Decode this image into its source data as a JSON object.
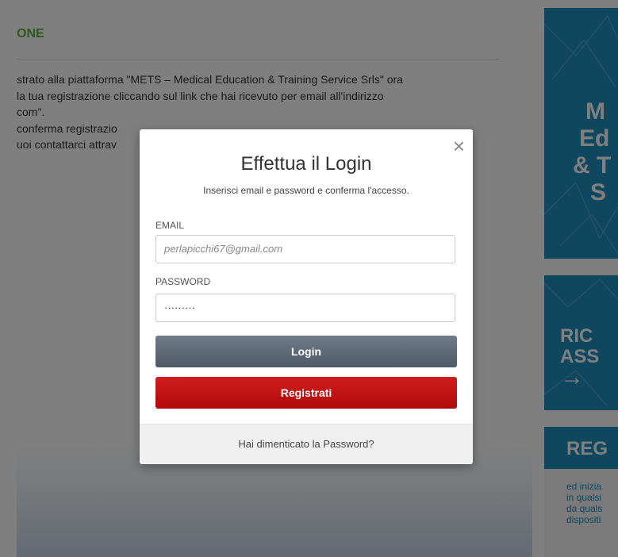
{
  "background": {
    "section_title": "ONE",
    "body_lines": [
      "strato alla piattaforma \"METS – Medical Education & Training Service Srls\" ora",
      "la tua registrazione cliccando sul link che hai ricevuto per email all'indirizzo",
      "com\".",
      "conferma registrazio",
      "uoi contattarci attrav"
    ],
    "accent_color": "#5fb03a"
  },
  "sidebar": {
    "box1_lines": [
      "M",
      "Ed",
      "& T",
      "S"
    ],
    "box2_lines": [
      "RIC",
      "ASS",
      "→"
    ],
    "box3_title": "REG",
    "box3_lines": [
      "ed inizia",
      "in qualsi",
      "da quals",
      "dispositi"
    ],
    "brand_color": "#1e8fbf"
  },
  "modal": {
    "title": "Effettua il Login",
    "subtitle": "Inserisci email e password e conferma l'accesso.",
    "email_label": "EMAIL",
    "email_value": "perlapicchi67@gmail.com",
    "password_label": "PASSWORD",
    "password_value": "·········",
    "login_label": "Login",
    "register_label": "Registrati",
    "forgot_label": "Hai dimenticato la Password?",
    "close_glyph": "×",
    "login_color": "#5a6571",
    "register_color": "#c41212"
  }
}
